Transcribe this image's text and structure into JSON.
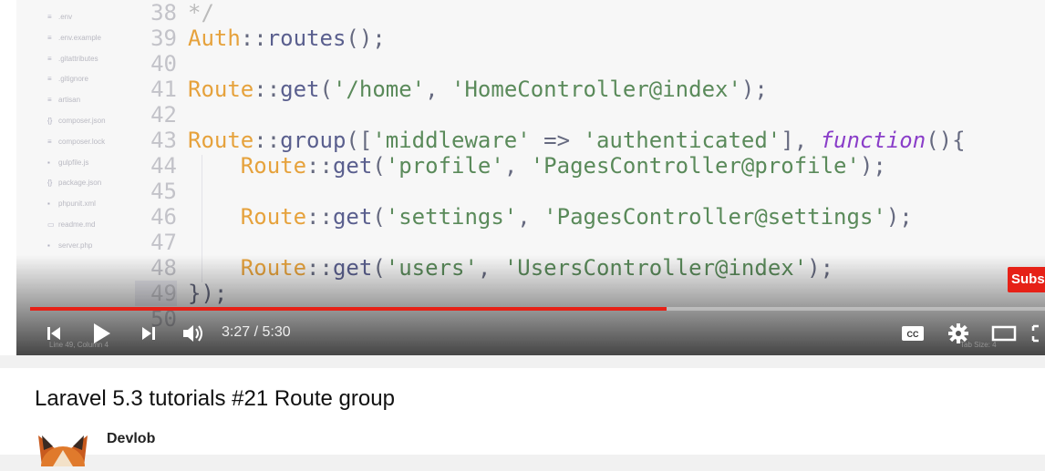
{
  "sidebar": {
    "files": [
      {
        "icon": "file-icon",
        "glyph": "≡",
        "name": ".env"
      },
      {
        "icon": "file-icon",
        "glyph": "≡",
        "name": ".env.example"
      },
      {
        "icon": "file-icon",
        "glyph": "≡",
        "name": ".gitattributes"
      },
      {
        "icon": "file-icon",
        "glyph": "≡",
        "name": ".gitignore"
      },
      {
        "icon": "file-icon",
        "glyph": "≡",
        "name": "artisan"
      },
      {
        "icon": "json-icon",
        "glyph": "{}",
        "name": "composer.json"
      },
      {
        "icon": "file-icon",
        "glyph": "≡",
        "name": "composer.lock"
      },
      {
        "icon": "gulp-icon",
        "glyph": "▪",
        "name": "gulpfile.js"
      },
      {
        "icon": "json-icon",
        "glyph": "{}",
        "name": "package.json"
      },
      {
        "icon": "xml-icon",
        "glyph": "▪",
        "name": "phpunit.xml"
      },
      {
        "icon": "markdown-icon",
        "glyph": "▭",
        "name": "readme.md"
      },
      {
        "icon": "php-icon",
        "glyph": "▪",
        "name": "server.php"
      }
    ]
  },
  "code": {
    "lines": [
      {
        "n": "38",
        "tokens": [
          {
            "t": "*/",
            "c": "cm"
          }
        ]
      },
      {
        "n": "39",
        "tokens": [
          {
            "t": "Auth",
            "c": "cls"
          },
          {
            "t": "::",
            "c": "pun"
          },
          {
            "t": "routes",
            "c": "fn"
          },
          {
            "t": "();",
            "c": "pun"
          }
        ]
      },
      {
        "n": "40",
        "tokens": []
      },
      {
        "n": "41",
        "tokens": [
          {
            "t": "Route",
            "c": "cls"
          },
          {
            "t": "::",
            "c": "pun"
          },
          {
            "t": "get",
            "c": "fn"
          },
          {
            "t": "(",
            "c": "pun"
          },
          {
            "t": "'/home'",
            "c": "str"
          },
          {
            "t": ", ",
            "c": "pun"
          },
          {
            "t": "'HomeController@index'",
            "c": "str"
          },
          {
            "t": ");",
            "c": "pun"
          }
        ]
      },
      {
        "n": "42",
        "tokens": []
      },
      {
        "n": "43",
        "tokens": [
          {
            "t": "Route",
            "c": "cls"
          },
          {
            "t": "::",
            "c": "pun"
          },
          {
            "t": "group",
            "c": "fn"
          },
          {
            "t": "([",
            "c": "pun"
          },
          {
            "t": "'middleware'",
            "c": "str"
          },
          {
            "t": " => ",
            "c": "pun"
          },
          {
            "t": "'authenticated'",
            "c": "str"
          },
          {
            "t": "], ",
            "c": "pun"
          },
          {
            "t": "function",
            "c": "kw"
          },
          {
            "t": "(){",
            "c": "pun"
          }
        ]
      },
      {
        "n": "44",
        "tokens": [
          {
            "t": "    ",
            "c": "pun"
          },
          {
            "t": "Route",
            "c": "cls"
          },
          {
            "t": "::",
            "c": "pun"
          },
          {
            "t": "get",
            "c": "fn"
          },
          {
            "t": "(",
            "c": "pun"
          },
          {
            "t": "'profile'",
            "c": "str"
          },
          {
            "t": ", ",
            "c": "pun"
          },
          {
            "t": "'PagesController@profile'",
            "c": "str"
          },
          {
            "t": ");",
            "c": "pun"
          }
        ]
      },
      {
        "n": "45",
        "tokens": []
      },
      {
        "n": "46",
        "tokens": [
          {
            "t": "    ",
            "c": "pun"
          },
          {
            "t": "Route",
            "c": "cls"
          },
          {
            "t": "::",
            "c": "pun"
          },
          {
            "t": "get",
            "c": "fn"
          },
          {
            "t": "(",
            "c": "pun"
          },
          {
            "t": "'settings'",
            "c": "str"
          },
          {
            "t": ", ",
            "c": "pun"
          },
          {
            "t": "'PagesController@settings'",
            "c": "str"
          },
          {
            "t": ");",
            "c": "pun"
          }
        ]
      },
      {
        "n": "47",
        "tokens": []
      },
      {
        "n": "48",
        "tokens": [
          {
            "t": "    ",
            "c": "pun"
          },
          {
            "t": "Route",
            "c": "cls"
          },
          {
            "t": "::",
            "c": "pun"
          },
          {
            "t": "get",
            "c": "fn"
          },
          {
            "t": "(",
            "c": "pun"
          },
          {
            "t": "'users'",
            "c": "str"
          },
          {
            "t": ", ",
            "c": "pun"
          },
          {
            "t": "'UsersController@index'",
            "c": "str"
          },
          {
            "t": ");",
            "c": "pun"
          }
        ]
      },
      {
        "n": "49",
        "hl": true,
        "tokens": [
          {
            "t": "});",
            "c": "pun"
          }
        ]
      },
      {
        "n": "50",
        "tokens": []
      }
    ]
  },
  "editor_status": {
    "left": "Line 49, Column 4",
    "right": "Tab Size: 4"
  },
  "player": {
    "current_time": "3:27",
    "duration": "5:30",
    "time_display": "3:27 / 5:30",
    "progress_fraction": 0.627,
    "subscribe_label": "Subsc",
    "accent_color": "#e62117"
  },
  "video": {
    "title": "Laravel 5.3 tutorials #21 Route group",
    "channel": "Devlob"
  }
}
